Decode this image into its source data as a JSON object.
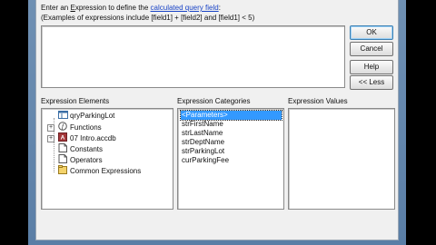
{
  "prompt": {
    "line1_before": "Enter an ",
    "line1_underlined": "E",
    "line1_middle": "xpression to define the ",
    "line1_link": "calculated query field",
    "line1_after": ":",
    "line2": "(Examples of expressions include [field1] + [field2] and [field1] < 5)"
  },
  "expression": {
    "value": ""
  },
  "buttons": {
    "ok": "OK",
    "cancel": "Cancel",
    "help": "Help",
    "less": "<< Less"
  },
  "panels": {
    "elements_label": "Expression Elements",
    "categories_label": "Expression Categories",
    "values_label": "Expression Values"
  },
  "elements": [
    {
      "label": "qryParkingLot",
      "icon": "query-icon",
      "expandable": false
    },
    {
      "label": "Functions",
      "icon": "functions-icon",
      "expandable": true
    },
    {
      "label": "07 Intro.accdb",
      "icon": "database-icon",
      "expandable": true
    },
    {
      "label": "Constants",
      "icon": "constants-icon",
      "expandable": false
    },
    {
      "label": "Operators",
      "icon": "operators-icon",
      "expandable": false
    },
    {
      "label": "Common Expressions",
      "icon": "common-expressions-icon",
      "expandable": false
    }
  ],
  "categories": [
    {
      "label": "<Parameters>",
      "selected": true
    },
    {
      "label": "strFirstName",
      "selected": false
    },
    {
      "label": "strLastName",
      "selected": false
    },
    {
      "label": "strDeptName",
      "selected": false
    },
    {
      "label": "strParkingLot",
      "selected": false
    },
    {
      "label": "curParkingFee",
      "selected": false
    }
  ]
}
